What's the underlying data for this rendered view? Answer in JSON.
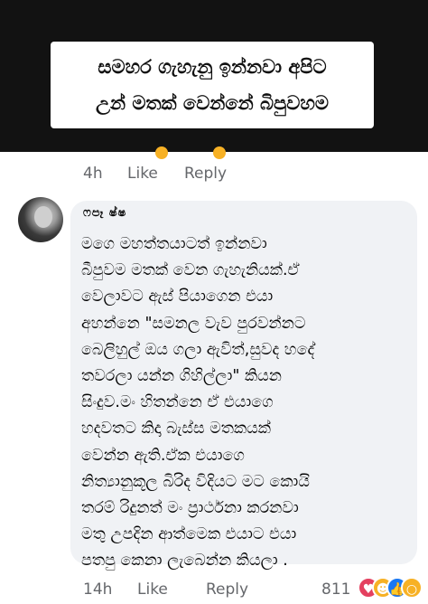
{
  "banner": {
    "line1": "සමහර ගැහැනු ඉන්නවා අපිට",
    "line2": "උන් මතක් වෙන්නේ බිපුවහම"
  },
  "top_actions": {
    "time": "4h",
    "like": "Like",
    "reply": "Reply"
  },
  "comment": {
    "author": "ෆපෑ ෂ්ෂ",
    "lines": [
      "මගෙ මහත්තයාටත් ඉන්නවා",
      "බීපුවම මතක් වෙන ගැහැනියක්.ඒ",
      "වෙලාවට ඇස් පියාගෙන එයා",
      "අහන්නෙ \"සමනල වැව පුරවන්නට",
      "බෙලිහුල් ඔය ගලා ඇවිත්,සුවද හදේ",
      "තවරලා යන්න ගිහිල්ලා\" කියන",
      "සිංදුව.මං හිතන්නෙ ඒ එයාගෙ",
      "හදවතට කිදා බැස්ස මතකයක්",
      "වෙන්න ඇති.ඒක එයාගෙ",
      "නිත්‍යානුකූල බිරිද විදියට මට කොයි",
      "තරම් රිදුනත් මං ප්‍රාර්ථනා කරනවා",
      "මතු උපදින ආත්මෙක එයාට එයා",
      "පතපු කෙනා ලැබෙන්න කියලා ."
    ]
  },
  "bottom_actions": {
    "time": "14h",
    "like": "Like",
    "reply": "Reply",
    "reaction_count": "811"
  },
  "reactions": [
    "heart-icon",
    "laugh-icon",
    "like-icon",
    "wow-icon"
  ],
  "colors": {
    "banner_bg": "#121212",
    "bubble_bg": "#f0f2f5",
    "meta_text": "#65676b",
    "heart": "#e4405f",
    "like": "#1877f2",
    "haha": "#f7b125"
  }
}
